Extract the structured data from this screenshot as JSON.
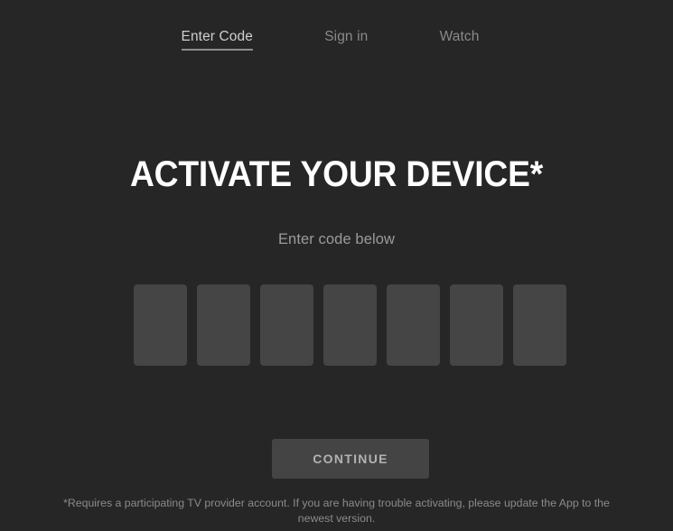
{
  "colors": {
    "background": "#262626",
    "box_fill": "#454545",
    "button_fill": "#444444",
    "active_tab_text": "#cfcfcf",
    "inactive_tab_text": "#8a8a8a",
    "title_text": "#ffffff",
    "subtitle_text": "#9b9b9b",
    "footer_text": "#8b8b8b",
    "underline": "#8d8d8d"
  },
  "nav": {
    "tabs": [
      {
        "label": "Enter Code",
        "active": true
      },
      {
        "label": "Sign in",
        "active": false
      },
      {
        "label": "Watch",
        "active": false
      }
    ]
  },
  "main": {
    "title": "ACTIVATE YOUR DEVICE*",
    "subtitle": "Enter code below",
    "code_entry": {
      "length": 7,
      "values": [
        "",
        "",
        "",
        "",
        "",
        "",
        ""
      ],
      "placeholder": ""
    },
    "continue_label": "CONTINUE"
  },
  "footer": {
    "disclaimer": "*Requires a participating TV provider account. If you are having trouble activating, please update the App to the newest version."
  }
}
